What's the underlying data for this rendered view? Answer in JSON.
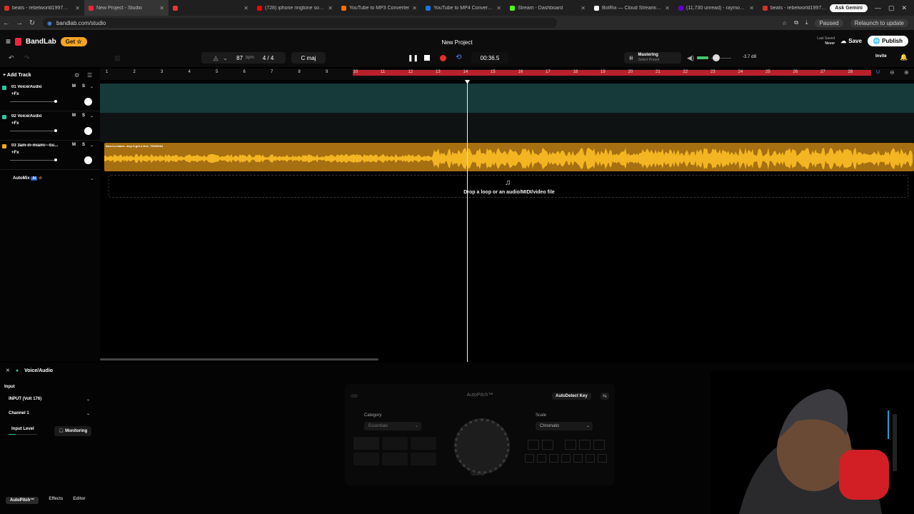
{
  "browser": {
    "tabs": [
      {
        "label": "beats - rebelworld1997@gmai",
        "color": "#d93025"
      },
      {
        "label": "New Project - Studio",
        "color": "#f1253b",
        "active": true
      },
      {
        "label": "",
        "color": "#e53935"
      },
      {
        "label": "(728) iphone ringtone sound e",
        "color": "#ff0000"
      },
      {
        "label": "YouTube to MP3 Converter",
        "color": "#ff6d00"
      },
      {
        "label": "YouTube to MP4 Converter | Fr",
        "color": "#1a73e8"
      },
      {
        "label": "Stream - Dashboard",
        "color": "#53fc18"
      },
      {
        "label": "BotRix — Cloud Streaming Bot",
        "color": "#ffffff"
      },
      {
        "label": "(11,730 unread) - raymondwa",
        "color": "#6001d2"
      },
      {
        "label": "beats - rebelworld1997@gmai",
        "color": "#d93025"
      }
    ],
    "ask_gemini": "Ask Gemini",
    "url": "bandlab.com/studio",
    "paused": "Paused",
    "relaunch": "Relaunch to update"
  },
  "header": {
    "logo": "BandLab",
    "get_label": "Get",
    "project_title": "New Project",
    "last_saved_label": "Last Saved",
    "last_saved_value": "Never",
    "save_label": "Save",
    "publish_label": "Publish",
    "invite_label": "Invite"
  },
  "transport": {
    "bpm": "87",
    "bpm_unit": "bpm",
    "time_signature": "4 / 4",
    "key": "C maj",
    "time": "00:36.5",
    "mastering_label": "Mastering",
    "mastering_preset": "Select Preset",
    "master_db": "-3.7 dB"
  },
  "ruler": {
    "bars": [
      "1",
      "2",
      "3",
      "4",
      "5",
      "6",
      "7",
      "8",
      "9",
      "10",
      "11",
      "12",
      "13",
      "14",
      "15",
      "16",
      "17",
      "18",
      "19",
      "20",
      "21",
      "22",
      "23",
      "24",
      "25",
      "26",
      "27",
      "28"
    ]
  },
  "tracks": [
    {
      "name": "01 Voice/Audio",
      "fx": "+Fx",
      "color": "#34c3a0"
    },
    {
      "name": "02 Voice/Audio",
      "fx": "+Fx",
      "color": "#34c3a0"
    },
    {
      "name": "03 3am-in-miami---bu...",
      "fx": "+Fx",
      "color": "#f0a91e"
    }
  ],
  "add_track_label": "Add Track",
  "mute_label": "M",
  "solo_label": "S",
  "automix": {
    "label": "AutoMix",
    "badge": "AI"
  },
  "clip_label": "3am-in-miami---boy-3-get-1-free_76320694",
  "dropzone_text": "Drop a loop or an audio/MIDI/video file",
  "bottom": {
    "track_name": "Voice/Audio",
    "input_label": "Input",
    "input_device": "INPUT (Volt 176)",
    "channel": "Channel 1",
    "input_level_label": "Input Level",
    "monitoring_label": "Monitoring",
    "autopitch_title": "AutoPitch™",
    "autodetect_label": "AutoDetect Key",
    "category_label": "Category",
    "category_value": "Essentials",
    "scale_label": "Scale",
    "scale_value": "Chromatic",
    "knob_label": "Neutral",
    "tabs": [
      "AutoPitch™",
      "Effects",
      "Editor"
    ]
  }
}
